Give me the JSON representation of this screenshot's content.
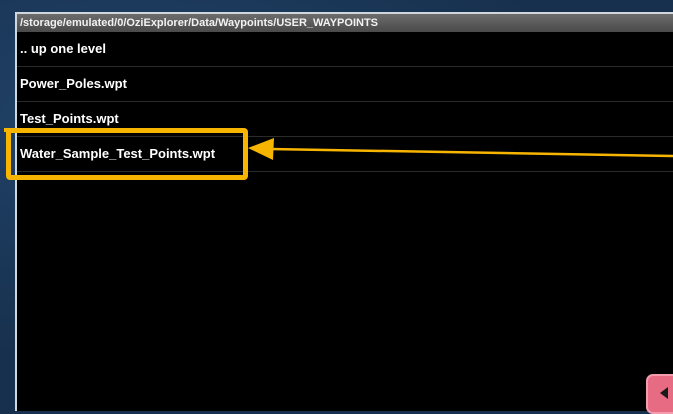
{
  "header": {
    "path": "/storage/emulated/0/OziExplorer/Data/Waypoints/USER_WAYPOINTS"
  },
  "file_list": {
    "items": [
      {
        "label": ".. up one level"
      },
      {
        "label": "Power_Poles.wpt"
      },
      {
        "label": "Test_Points.wpt"
      },
      {
        "label": "Water_Sample_Test_Points.wpt",
        "highlighted": true
      }
    ]
  },
  "annotation": {
    "color": "#f7b500",
    "target": "Water_Sample_Test_Points.wpt"
  },
  "corner_button": {
    "icon": "left-arrow-icon",
    "color": "#e86b84"
  }
}
